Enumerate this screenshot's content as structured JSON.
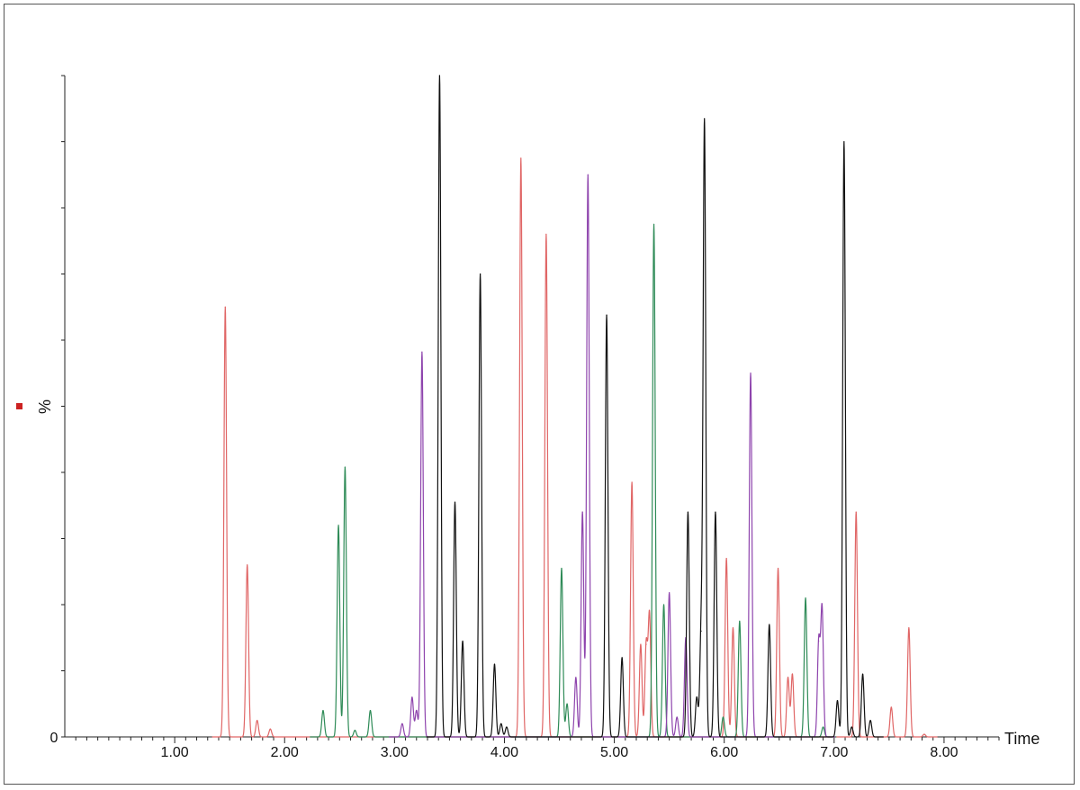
{
  "chart_data": {
    "type": "line",
    "title": "",
    "xlabel": "Time",
    "ylabel": "%",
    "xlim": [
      0.0,
      8.5
    ],
    "ylim": [
      0,
      100
    ],
    "y_tick_labels": [
      {
        "value": 0,
        "label": "0"
      }
    ],
    "x_tick_labels": [
      {
        "value": 1.0,
        "label": "1.00"
      },
      {
        "value": 2.0,
        "label": "2.00"
      },
      {
        "value": 3.0,
        "label": "3.00"
      },
      {
        "value": 4.0,
        "label": "4.00"
      },
      {
        "value": 5.0,
        "label": "5.00"
      },
      {
        "value": 6.0,
        "label": "6.00"
      },
      {
        "value": 7.0,
        "label": "7.00"
      },
      {
        "value": 8.0,
        "label": "8.00"
      }
    ],
    "grid": false,
    "legend_marker_color": "#cc2222",
    "peak_width": 0.012,
    "series": [
      {
        "color": "#e06666",
        "peaks": [
          {
            "x": 1.46,
            "y": 65.0
          },
          {
            "x": 1.66,
            "y": 26.0
          },
          {
            "x": 1.75,
            "y": 2.5
          },
          {
            "x": 1.87,
            "y": 1.2
          },
          {
            "x": 4.15,
            "y": 87.5
          },
          {
            "x": 4.38,
            "y": 76.0
          },
          {
            "x": 5.16,
            "y": 38.5
          },
          {
            "x": 5.24,
            "y": 14.0
          },
          {
            "x": 5.29,
            "y": 14.0
          },
          {
            "x": 5.32,
            "y": 18.5
          },
          {
            "x": 6.02,
            "y": 27.0
          },
          {
            "x": 6.08,
            "y": 16.5
          },
          {
            "x": 6.49,
            "y": 25.5
          },
          {
            "x": 6.58,
            "y": 9.0
          },
          {
            "x": 6.62,
            "y": 9.5
          },
          {
            "x": 7.2,
            "y": 34.0
          },
          {
            "x": 7.52,
            "y": 4.5
          },
          {
            "x": 7.68,
            "y": 16.5
          },
          {
            "x": 7.82,
            "y": 0.4
          }
        ]
      },
      {
        "color": "#2e8b57",
        "peaks": [
          {
            "x": 2.35,
            "y": 4.0
          },
          {
            "x": 2.49,
            "y": 32.0
          },
          {
            "x": 2.55,
            "y": 40.8
          },
          {
            "x": 2.64,
            "y": 1.0
          },
          {
            "x": 2.78,
            "y": 4.0
          },
          {
            "x": 4.52,
            "y": 25.5
          },
          {
            "x": 4.57,
            "y": 5.0
          },
          {
            "x": 5.36,
            "y": 77.5
          },
          {
            "x": 5.45,
            "y": 20.0
          },
          {
            "x": 5.99,
            "y": 3.0
          },
          {
            "x": 6.14,
            "y": 17.5
          },
          {
            "x": 6.74,
            "y": 21.0
          },
          {
            "x": 6.9,
            "y": 1.5
          }
        ]
      },
      {
        "color": "#8e44ad",
        "peaks": [
          {
            "x": 3.07,
            "y": 2.0
          },
          {
            "x": 3.16,
            "y": 6.0
          },
          {
            "x": 3.2,
            "y": 4.0
          },
          {
            "x": 3.25,
            "y": 58.2
          },
          {
            "x": 4.65,
            "y": 9.0
          },
          {
            "x": 4.71,
            "y": 34.0
          },
          {
            "x": 4.76,
            "y": 85.0
          },
          {
            "x": 5.5,
            "y": 21.8
          },
          {
            "x": 5.57,
            "y": 3.0
          },
          {
            "x": 5.65,
            "y": 15.0
          },
          {
            "x": 6.24,
            "y": 55.0
          },
          {
            "x": 6.86,
            "y": 14.5
          },
          {
            "x": 6.89,
            "y": 19.5
          }
        ]
      },
      {
        "color": "#111111",
        "peaks": [
          {
            "x": 3.41,
            "y": 100.0
          },
          {
            "x": 3.55,
            "y": 35.5
          },
          {
            "x": 3.62,
            "y": 14.5
          },
          {
            "x": 3.78,
            "y": 70.0
          },
          {
            "x": 3.91,
            "y": 11.0
          },
          {
            "x": 3.97,
            "y": 2.0
          },
          {
            "x": 4.02,
            "y": 1.5
          },
          {
            "x": 4.93,
            "y": 63.8
          },
          {
            "x": 5.07,
            "y": 12.0
          },
          {
            "x": 5.67,
            "y": 34.0
          },
          {
            "x": 5.75,
            "y": 6.0
          },
          {
            "x": 5.79,
            "y": 16.0
          },
          {
            "x": 5.82,
            "y": 92.8
          },
          {
            "x": 5.92,
            "y": 34.0
          },
          {
            "x": 6.41,
            "y": 17.0
          },
          {
            "x": 7.03,
            "y": 5.5
          },
          {
            "x": 7.09,
            "y": 90.0
          },
          {
            "x": 7.16,
            "y": 1.5
          },
          {
            "x": 7.26,
            "y": 9.5
          },
          {
            "x": 7.33,
            "y": 2.5
          }
        ]
      }
    ]
  }
}
